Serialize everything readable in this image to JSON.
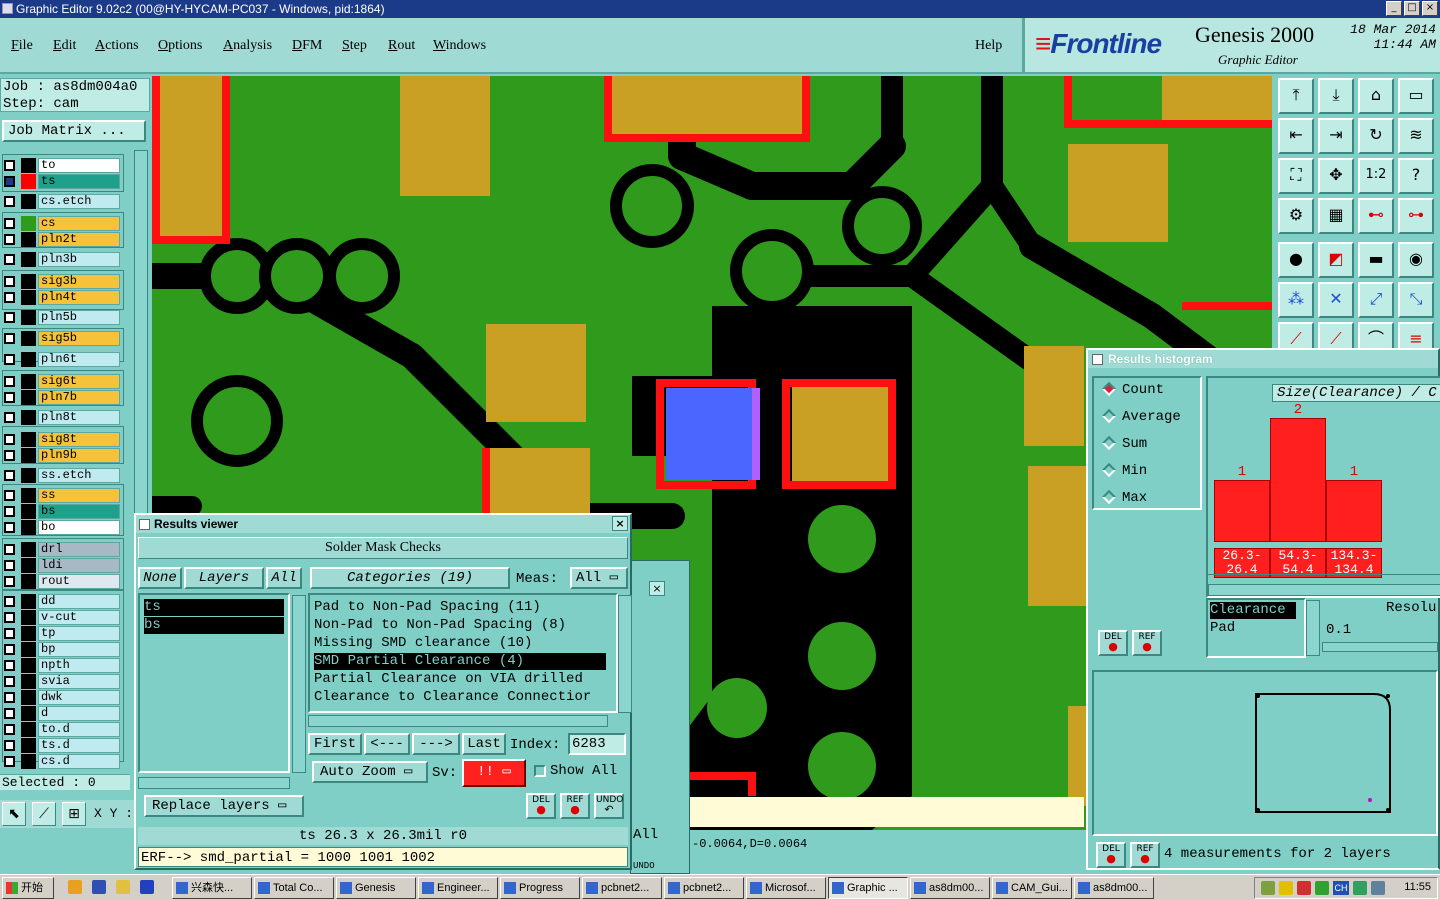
{
  "window": {
    "title": "Graphic Editor 9.02c2 (00@HY-HYCAM-PC037 - Windows, pid:1864)"
  },
  "menu": {
    "items": [
      {
        "first": "F",
        "rest": "ile"
      },
      {
        "first": "E",
        "rest": "dit"
      },
      {
        "first": "A",
        "rest": "ctions"
      },
      {
        "first": "O",
        "rest": "ptions"
      },
      {
        "first": "A",
        "rest": "nalysis"
      },
      {
        "first": "D",
        "rest": "FM"
      },
      {
        "first": "S",
        "rest": "tep"
      },
      {
        "first": "R",
        "rest": "out"
      },
      {
        "first": "W",
        "rest": "indows"
      }
    ],
    "help": "Help"
  },
  "brand": {
    "logo": "Frontline",
    "product": "Genesis 2000",
    "subtitle": "Graphic Editor",
    "date": "18 Mar 2014",
    "time": "11:44 AM"
  },
  "job": {
    "job_line": "Job : as8dm004a0",
    "step_line": "Step: cam",
    "matrix_button": "Job Matrix ..."
  },
  "layers": [
    {
      "name": "to",
      "color": "#ffffff",
      "swatch": "#000000",
      "checked": false
    },
    {
      "name": "ts",
      "color": "#1fa08a",
      "swatch": "#ff0000",
      "checked": true
    },
    {
      "name": "cs.etch",
      "color": "#bfeaf0",
      "swatch": "#000000",
      "checked": false
    },
    {
      "name": "cs",
      "color": "#f5c23a",
      "swatch": "#2f9a1c",
      "checked": false
    },
    {
      "name": "pln2t",
      "color": "#f5c23a",
      "swatch": "#000000",
      "checked": false
    },
    {
      "name": "pln3b",
      "color": "#bfeaf0",
      "swatch": "#000000",
      "checked": false
    },
    {
      "name": "sig3b",
      "color": "#f5c23a",
      "swatch": "#000000",
      "checked": false
    },
    {
      "name": "pln4t",
      "color": "#f5c23a",
      "swatch": "#000000",
      "checked": false
    },
    {
      "name": "pln5b",
      "color": "#bfeaf0",
      "swatch": "#000000",
      "checked": false
    },
    {
      "name": "sig5b",
      "color": "#f5c23a",
      "swatch": "#000000",
      "checked": false
    },
    {
      "name": "pln6t",
      "color": "#bfeaf0",
      "swatch": "#000000",
      "checked": false
    },
    {
      "name": "sig6t",
      "color": "#f5c23a",
      "swatch": "#000000",
      "checked": false
    },
    {
      "name": "pln7b",
      "color": "#f5c23a",
      "swatch": "#000000",
      "checked": false
    },
    {
      "name": "pln8t",
      "color": "#bfeaf0",
      "swatch": "#000000",
      "checked": false
    },
    {
      "name": "sig8t",
      "color": "#f5c23a",
      "swatch": "#000000",
      "checked": false
    },
    {
      "name": "pln9b",
      "color": "#f5c23a",
      "swatch": "#000000",
      "checked": false
    },
    {
      "name": "ss.etch",
      "color": "#bfeaf0",
      "swatch": "#000000",
      "checked": false
    },
    {
      "name": "ss",
      "color": "#f5c23a",
      "swatch": "#000000",
      "checked": false
    },
    {
      "name": "bs",
      "color": "#1fa08a",
      "swatch": "#000000",
      "checked": false
    },
    {
      "name": "bo",
      "color": "#ffffff",
      "swatch": "#000000",
      "checked": false
    },
    {
      "name": "drl",
      "color": "#a8b8c4",
      "swatch": "#000000",
      "checked": false
    },
    {
      "name": "ldi",
      "color": "#a8b8c4",
      "swatch": "#000000",
      "checked": false
    },
    {
      "name": "rout",
      "color": "#dfe8ee",
      "swatch": "#000000",
      "checked": false
    },
    {
      "name": "dd",
      "color": "#bfeaf0",
      "swatch": "#000000",
      "checked": false
    },
    {
      "name": "v-cut",
      "color": "#bfeaf0",
      "swatch": "#000000",
      "checked": false
    },
    {
      "name": "tp",
      "color": "#bfeaf0",
      "swatch": "#000000",
      "checked": false
    },
    {
      "name": "bp",
      "color": "#bfeaf0",
      "swatch": "#000000",
      "checked": false
    },
    {
      "name": "npth",
      "color": "#bfeaf0",
      "swatch": "#000000",
      "checked": false
    },
    {
      "name": "svia",
      "color": "#bfeaf0",
      "swatch": "#000000",
      "checked": false
    },
    {
      "name": "dwk",
      "color": "#bfeaf0",
      "swatch": "#000000",
      "checked": false
    },
    {
      "name": "d",
      "color": "#bfeaf0",
      "swatch": "#000000",
      "checked": false
    },
    {
      "name": "to.d",
      "color": "#bfeaf0",
      "swatch": "#000000",
      "checked": false
    },
    {
      "name": "ts.d",
      "color": "#bfeaf0",
      "swatch": "#000000",
      "checked": false
    },
    {
      "name": "cs.d",
      "color": "#bfeaf0",
      "swatch": "#000000",
      "checked": false
    }
  ],
  "left": {
    "selected": "Selected : 0",
    "xy_label": "X Y :"
  },
  "results_viewer": {
    "title": "Results viewer",
    "header": "Solder Mask Checks",
    "none_btn": "None",
    "layers_btn": "Layers",
    "all_btn": "All",
    "categories_btn": "Categories (19)",
    "meas_label": "Meas:",
    "meas_value": "All",
    "layer_list": [
      "ts",
      "bs"
    ],
    "categories": [
      "Pad to Non-Pad Spacing (11)",
      "Non-Pad to Non-Pad Spacing (8)",
      "Missing SMD clearance (10)",
      "SMD Partial Clearance (4)",
      "Partial Clearance on VIA drilled",
      "Clearance to Clearance Connectior"
    ],
    "selected_category": 3,
    "first_btn": "First",
    "prev_btn": "<---",
    "next_btn": "--->",
    "last_btn": "Last",
    "index_label": "Index:",
    "index_value": "6283",
    "autozoom_btn": "Auto Zoom",
    "sv_label": "Sv:",
    "sv_value": "!!",
    "show_all": "Show All",
    "replace_btn": "Replace layers",
    "del_btn": "DEL",
    "ref_btn": "REF",
    "undo_btn": "UNDO",
    "status_line": "ts 26.3 x 26.3mil  r0",
    "erf_line": "ERF--> smd_partial = 1000 1001 1002"
  },
  "behind": {
    "all_text": "All",
    "undo_text": "UNDO"
  },
  "coords": {
    "text": "-0.0064,D=0.0064"
  },
  "histogram": {
    "title": "Results histogram",
    "options": [
      "Count",
      "Average",
      "Sum",
      "Min",
      "Max"
    ],
    "selected_option": 0,
    "size_label": "Size(Clearance) / C",
    "panel_list": [
      "Clearance",
      "Pad"
    ],
    "resolu_label": "Resolu",
    "resolu_value": "0.1",
    "del_btn": "DEL",
    "ref_btn": "REF",
    "summary": "4 measurements for 2 layers"
  },
  "chart_data": {
    "type": "bar",
    "categories": [
      "26.3- 26.4",
      "54.3- 54.4",
      "134.3- 134.4"
    ],
    "values": [
      1,
      2,
      1
    ],
    "title": "Size(Clearance) / C",
    "ylim": [
      0,
      2
    ],
    "grid": false
  },
  "taskbar": {
    "start": "开始",
    "tasks": [
      "兴森快...",
      "Total Co...",
      "Genesis",
      "Engineer...",
      "Progress",
      "pcbnet2...",
      "pcbnet2...",
      "Microsof...",
      "Graphic ...",
      "as8dm00...",
      "CAM_Gui...",
      "as8dm00..."
    ],
    "active_task": 8,
    "tray_ime": "CH",
    "clock": "11:55"
  },
  "colors": {
    "teal_bg": "#7fcfc6",
    "pcb_green": "#2f9a1c",
    "pad_gold": "#c9a024",
    "clearance_red": "#ff1010",
    "highlight_blue": "#4a66ff",
    "bar_red": "#ff1f1f"
  },
  "icons": {
    "toolbox": [
      "pan-top-icon",
      "pan-down-icon",
      "home-icon",
      "window-icon",
      "pan-left-icon",
      "pan-right-icon",
      "refresh-icon",
      "redraw-icon",
      "fit-icon",
      "zoom-center-icon",
      "one-to-one-icon",
      "help-icon",
      "drill-icon",
      "grid-icon",
      "net-icon",
      "net2-icon"
    ]
  }
}
